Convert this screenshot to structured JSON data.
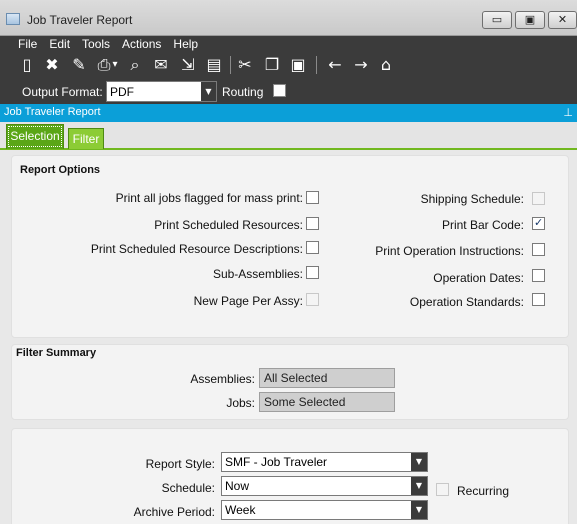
{
  "window": {
    "title": "Job Traveler Report",
    "minimize_glyph": "▭",
    "maximize_glyph": "▣",
    "close_glyph": "✕"
  },
  "menu": [
    "File",
    "Edit",
    "Tools",
    "Actions",
    "Help"
  ],
  "toolbar": {
    "icons": [
      {
        "name": "new-icon",
        "glyph": "▯"
      },
      {
        "name": "delete-icon",
        "glyph": "✖"
      },
      {
        "name": "clear-icon",
        "glyph": "✎"
      },
      {
        "name": "print-icon",
        "glyph": "⎙"
      },
      {
        "name": "print-dropdown-icon",
        "glyph": "▾"
      },
      {
        "name": "print-preview-icon",
        "glyph": "⌕"
      },
      {
        "name": "email-icon",
        "glyph": "✉"
      },
      {
        "name": "submit-icon",
        "glyph": "⇲"
      },
      {
        "name": "schedule-icon",
        "glyph": "▤"
      },
      {
        "name": "cut-icon",
        "glyph": "✂"
      },
      {
        "name": "copy-icon",
        "glyph": "❐"
      },
      {
        "name": "paste-icon",
        "glyph": "▣"
      },
      {
        "name": "back-icon",
        "glyph": "←"
      },
      {
        "name": "forward-icon",
        "glyph": "→"
      },
      {
        "name": "home-icon",
        "glyph": "⌂"
      }
    ],
    "output_format_label": "Output Format:",
    "output_format_value": "PDF",
    "routing_label": "Routing",
    "routing_checked": false
  },
  "panel": {
    "header": "Job Traveler Report",
    "pin_glyph": "⊥"
  },
  "tabs": [
    {
      "label": "Selection",
      "active": true
    },
    {
      "label": "Filter",
      "active": false
    }
  ],
  "report_options": {
    "title": "Report Options",
    "left": [
      {
        "label": "Print all jobs flagged for mass print:",
        "checked": false,
        "enabled": true
      },
      {
        "label": "Print Scheduled Resources:",
        "checked": false,
        "enabled": true
      },
      {
        "label": "Print Scheduled Resource Descriptions:",
        "checked": false,
        "enabled": true
      },
      {
        "label": "Sub-Assemblies:",
        "checked": false,
        "enabled": true
      },
      {
        "label": "New Page Per Assy:",
        "checked": false,
        "enabled": false
      }
    ],
    "right": [
      {
        "label": "Shipping Schedule:",
        "checked": false,
        "enabled": false
      },
      {
        "label": "Print Bar Code:",
        "checked": true,
        "enabled": true
      },
      {
        "label": "Print Operation Instructions:",
        "checked": false,
        "enabled": true
      },
      {
        "label": "Operation Dates:",
        "checked": false,
        "enabled": true
      },
      {
        "label": "Operation Standards:",
        "checked": false,
        "enabled": true
      }
    ]
  },
  "filter_summary": {
    "title": "Filter Summary",
    "assemblies_label": "Assemblies:",
    "assemblies_value": "All Selected",
    "jobs_label": "Jobs:",
    "jobs_value": "Some Selected"
  },
  "settings": {
    "report_style_label": "Report Style:",
    "report_style_value": "SMF - Job Traveler",
    "schedule_label": "Schedule:",
    "schedule_value": "Now",
    "recurring_label": "Recurring",
    "recurring_checked": false,
    "archive_period_label": "Archive Period:",
    "archive_period_value": "Week",
    "dropdown_glyph": "▼"
  }
}
